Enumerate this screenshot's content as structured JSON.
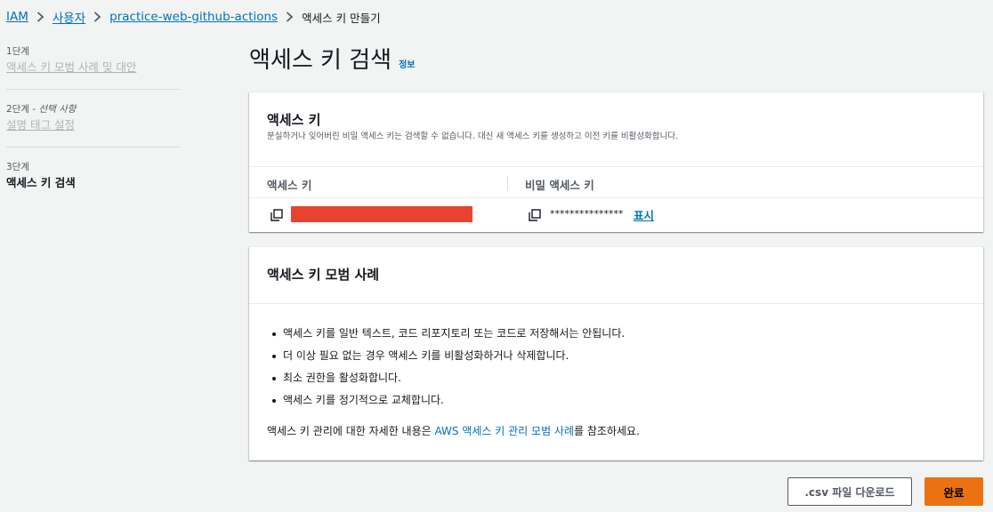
{
  "breadcrumb": {
    "items": [
      "IAM",
      "사용자",
      "practice-web-github-actions"
    ],
    "current": "액세스 키 만들기"
  },
  "steps": [
    {
      "number": "1단계",
      "optional": "",
      "title": "액세스 키 모범 사례 및 대안"
    },
    {
      "number": "2단계",
      "optional": "선택 사항",
      "title": "설명 태그 설정"
    },
    {
      "number": "3단계",
      "optional": "",
      "title": "액세스 키 검색"
    }
  ],
  "page": {
    "title": "액세스 키 검색",
    "info_link": "정보"
  },
  "access_key_panel": {
    "title": "액세스 키",
    "description": "분실하거나 잊어버린 비밀 액세스 키는 검색할 수 없습니다. 대신 새 액세스 키를 생성하고 이전 키를 비활성화합니다.",
    "columns": [
      "액세스 키",
      "비밀 액세스 키"
    ],
    "secret_masked": "***************",
    "show_link": "표시"
  },
  "best_practices": {
    "title": "액세스 키 모범 사례",
    "items": [
      "액세스 키를 일반 텍스트, 코드 리포지토리 또는 코드로 저장해서는 안됩니다.",
      "더 이상 필요 없는 경우 액세스 키를 비활성화하거나 삭제합니다.",
      "최소 권한을 활성화합니다.",
      "액세스 키를 정기적으로 교체합니다."
    ],
    "footnote_prefix": "액세스 키 관리에 대한 자세한 내용은 ",
    "footnote_link": "AWS 액세스 키 관리 모범 사례",
    "footnote_suffix": "를 참조하세요."
  },
  "buttons": {
    "csv": ".csv 파일 다운로드",
    "done": "완료"
  },
  "colors": {
    "accent": "#ec7211",
    "link": "#0073bb",
    "redaction": "#e8432e"
  }
}
